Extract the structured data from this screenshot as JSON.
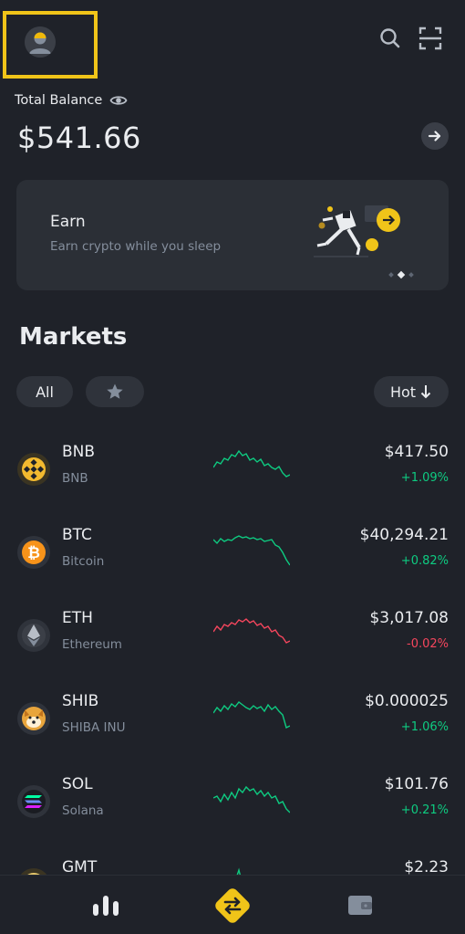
{
  "header": {
    "avatar_icon": "user-avatar-icon",
    "search_icon": "search-icon",
    "scan_icon": "scan-icon"
  },
  "balance": {
    "label": "Total Balance",
    "value": "$541.66",
    "eye_icon": "eye-icon",
    "arrow_icon": "arrow-right-icon"
  },
  "earn": {
    "title": "Earn",
    "subtitle": "Earn crypto while you sleep",
    "carousel_active_index": 1,
    "carousel_count": 3
  },
  "markets": {
    "title": "Markets",
    "filters": {
      "all_label": "All",
      "hot_label": "Hot",
      "sort_icon": "arrow-down-icon"
    },
    "rows": [
      {
        "symbol": "BNB",
        "name": "BNB",
        "price": "$417.50",
        "change": "+1.09%",
        "trend": "up",
        "icon": "bnb-icon"
      },
      {
        "symbol": "BTC",
        "name": "Bitcoin",
        "price": "$40,294.21",
        "change": "+0.82%",
        "trend": "up",
        "icon": "btc-icon"
      },
      {
        "symbol": "ETH",
        "name": "Ethereum",
        "price": "$3,017.08",
        "change": "-0.02%",
        "trend": "down",
        "icon": "eth-icon"
      },
      {
        "symbol": "SHIB",
        "name": "SHIBA INU",
        "price": "$0.000025",
        "change": "+1.06%",
        "trend": "up",
        "icon": "shib-icon"
      },
      {
        "symbol": "SOL",
        "name": "Solana",
        "price": "$101.76",
        "change": "+0.21%",
        "trend": "up",
        "icon": "sol-icon"
      },
      {
        "symbol": "GMT",
        "name": "",
        "price": "$2.23",
        "change": "",
        "trend": "up",
        "icon": "gmt-icon"
      }
    ]
  },
  "colors": {
    "background": "#1f2229",
    "card": "#2b2f36",
    "accent": "#f0c419",
    "up": "#0ecb81",
    "down": "#f6465d"
  }
}
